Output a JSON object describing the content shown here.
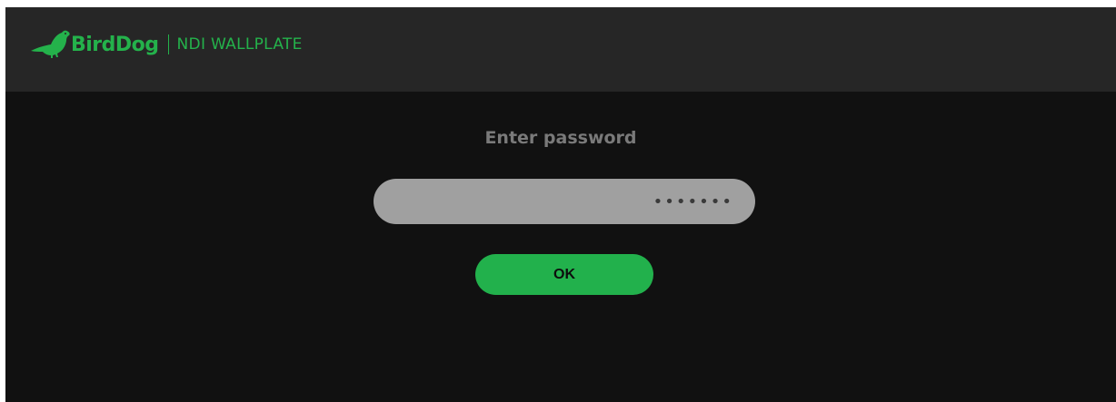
{
  "header": {
    "brand_name": "BirdDog",
    "divider": "|",
    "product_name": "NDI WALLPLATE",
    "logo_icon": "bird-icon"
  },
  "login": {
    "prompt": "Enter password",
    "password_value": "•••••••",
    "ok_label": "OK"
  },
  "colors": {
    "page_background": "#111111",
    "header_background": "#262626",
    "brand_green": "#24b24b",
    "prompt_text": "#7a7a7a",
    "field_background": "#a0a0a0",
    "field_text": "#3a3a3a",
    "button_background": "#22b14c",
    "button_text": "#0d0d0d"
  }
}
